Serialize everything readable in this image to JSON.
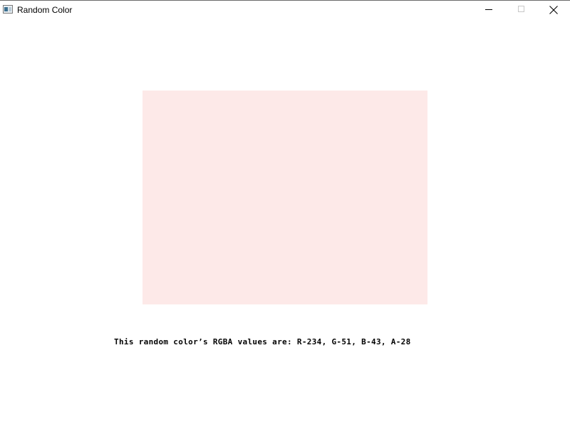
{
  "window": {
    "title": "Random Color"
  },
  "color": {
    "r": 234,
    "g": 51,
    "b": 43,
    "a": 28
  },
  "caption": {
    "text": "This random color’s RGBA values are: R-234, G-51, B-43, A-28"
  },
  "icons": {
    "app": "app-window-icon",
    "minimize": "minimize-icon",
    "maximize": "maximize-icon",
    "close": "close-icon"
  },
  "colors": {
    "background": "#ffffff",
    "text": "#000000",
    "maximize_disabled": "#c8c8c8"
  }
}
